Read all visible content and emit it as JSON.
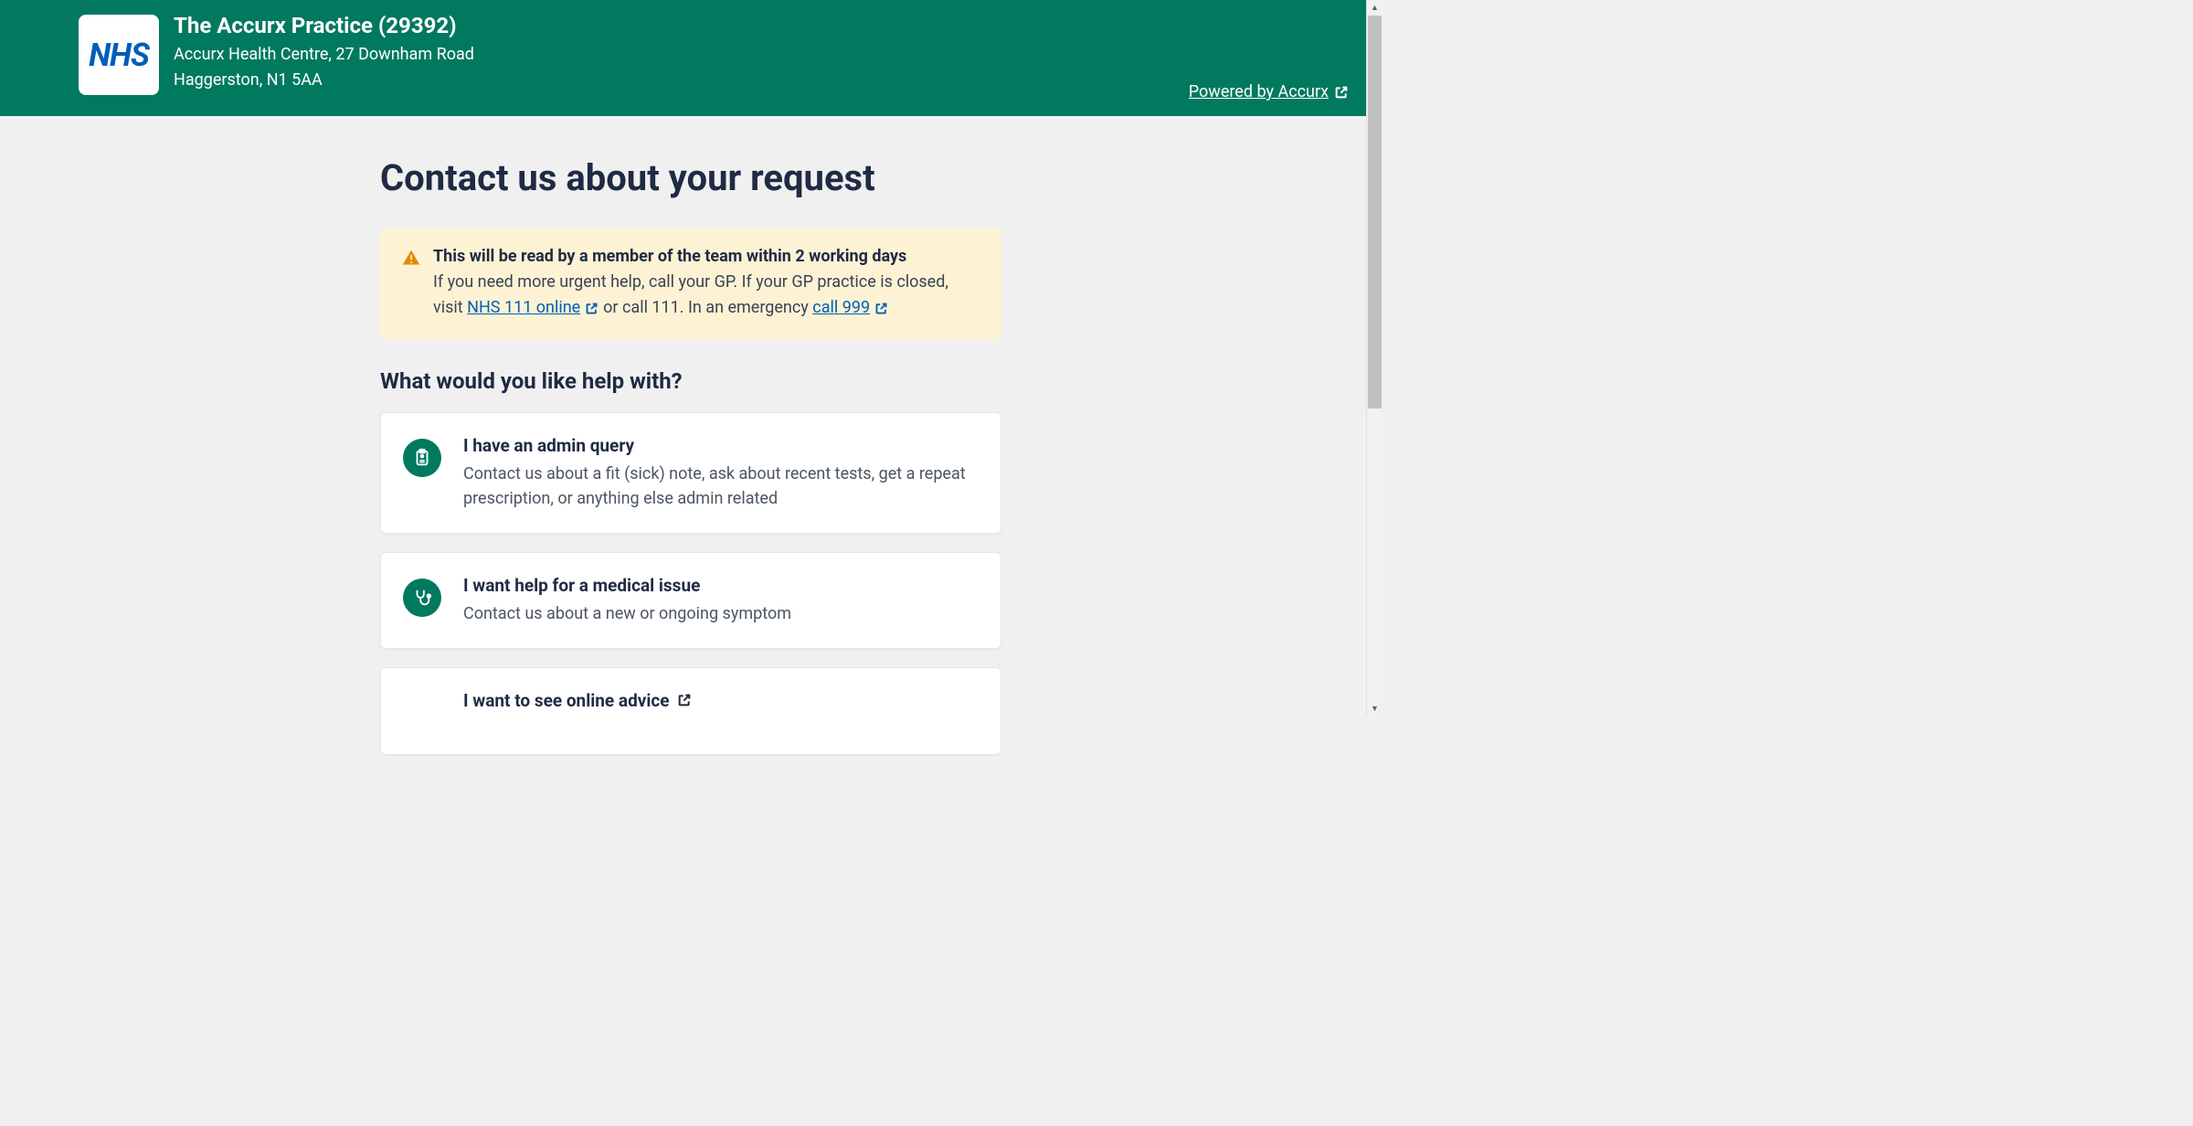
{
  "header": {
    "logo_text": "NHS",
    "practice_name": "The Accurx Practice (29392)",
    "address_line1": "Accurx Health Centre, 27 Downham Road",
    "address_line2": "Haggerston, N1 5AA",
    "powered_by": "Powered by Accurx"
  },
  "page_title": "Contact us about your request",
  "alert": {
    "title": "This will be read by a member of the team within 2 working days",
    "body_pre": "If you need more urgent help, call your GP. If your GP practice is closed, visit ",
    "link1": "NHS 111 online",
    "body_mid": " or call 111. In an emergency ",
    "link2": "call 999"
  },
  "subhead": "What would you like help with?",
  "options": [
    {
      "title": "I have an admin query",
      "desc": "Contact us about a fit (sick) note, ask about recent tests, get a repeat prescription, or anything else admin related"
    },
    {
      "title": "I want help for a medical issue",
      "desc": "Contact us about a new or ongoing symptom"
    },
    {
      "title": "I want to see online advice",
      "desc": ""
    }
  ]
}
